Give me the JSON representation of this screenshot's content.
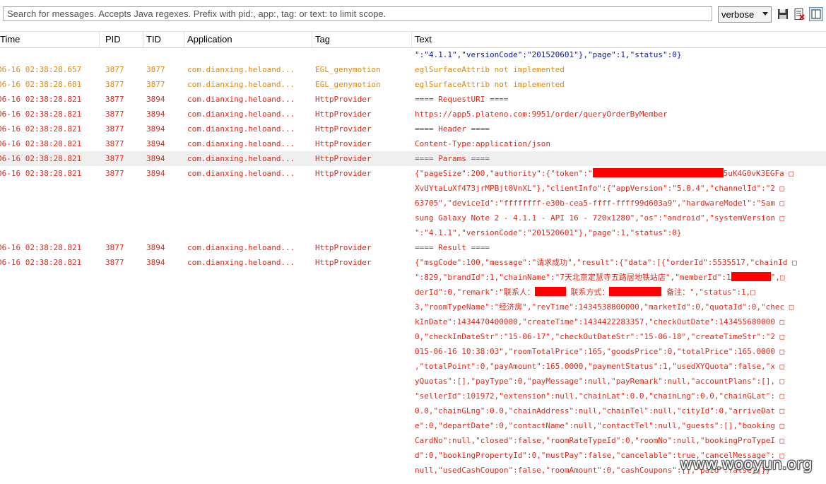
{
  "toolbar": {
    "search_placeholder": "Search for messages. Accepts Java regexes. Prefix with pid:, app:, tag: or text: to limit scope.",
    "level": "verbose",
    "icons": [
      "save-icon",
      "clear-log-icon",
      "toggle-columns-icon"
    ]
  },
  "columns": [
    "Time",
    "PID",
    "TID",
    "Application",
    "Tag",
    "Text"
  ],
  "rows": [
    {
      "time": "",
      "pid": "",
      "tid": "",
      "app": "",
      "tag": "",
      "text": "\":\"4.1.1\",\"versionCode\":\"201520601\"},\"page\":1,\"status\":0}",
      "color": "blue"
    },
    {
      "time": "06-16 02:38:28.657",
      "pid": "3877",
      "tid": "3877",
      "app": "com.dianxing.heloand...",
      "tag": "EGL_genymotion",
      "text": "eglSurfaceAttrib not implemented",
      "color": "orange"
    },
    {
      "time": "06-16 02:38:28.681",
      "pid": "3877",
      "tid": "3877",
      "app": "com.dianxing.heloand...",
      "tag": "EGL_genymotion",
      "text": "eglSurfaceAttrib not implemented",
      "color": "orange"
    },
    {
      "time": "06-16 02:38:28.821",
      "pid": "3877",
      "tid": "3894",
      "app": "com.dianxing.heloand...",
      "tag": "HttpProvider",
      "text": "==== RequestURI ====",
      "color": "red"
    },
    {
      "time": "06-16 02:38:28.821",
      "pid": "3877",
      "tid": "3894",
      "app": "com.dianxing.heloand...",
      "tag": "HttpProvider",
      "text": "https://app5.plateno.com:9951/order/queryOrderByMember",
      "color": "red"
    },
    {
      "time": "06-16 02:38:28.821",
      "pid": "3877",
      "tid": "3894",
      "app": "com.dianxing.heloand...",
      "tag": "HttpProvider",
      "text": "==== Header ====",
      "color": "red"
    },
    {
      "time": "06-16 02:38:28.821",
      "pid": "3877",
      "tid": "3894",
      "app": "com.dianxing.heloand...",
      "tag": "HttpProvider",
      "text": "Content-Type:application/json",
      "color": "red"
    },
    {
      "time": "06-16 02:38:28.821",
      "pid": "3877",
      "tid": "3894",
      "app": "com.dianxing.heloand...",
      "tag": "HttpProvider",
      "text": "==== Params ====",
      "color": "red",
      "selected": true
    },
    {
      "time": "06-16 02:38:28.821",
      "pid": "3877",
      "tid": "3894",
      "app": "com.dianxing.heloand...",
      "tag": "HttpProvider",
      "text_pre": "{\"pageSize\":200,\"authority\":{\"token\":\"",
      "text_post": "5uK4G0vK3EGFa □",
      "color": "red"
    },
    {
      "text": "XvUYtaLuXf473jrMPBjt0VnXL\"},\"clientInfo\":{\"appVersion\":\"5.0.4\",\"channelId\":\"2 □",
      "color": "red",
      "cont": true
    },
    {
      "text": "63705\",\"deviceId\":\"ffffffff-e30b-cea5-ffff-ffff99d603a9\",\"hardwareModel\":\"Sam □",
      "color": "red",
      "cont": true
    },
    {
      "text": "sung Galaxy Note 2 - 4.1.1 - API 16 - 720x1280\",\"os\":\"android\",\"systemVersion □",
      "color": "red",
      "cont": true
    },
    {
      "text": "\":\"4.1.1\",\"versionCode\":\"201520601\"},\"page\":1,\"status\":0}",
      "color": "red",
      "cont": true
    },
    {
      "time": "06-16 02:38:28.821",
      "pid": "3877",
      "tid": "3894",
      "app": "com.dianxing.heloand...",
      "tag": "HttpProvider",
      "text": "==== Result ====",
      "color": "red"
    },
    {
      "time": "06-16 02:38:28.821",
      "pid": "3877",
      "tid": "3894",
      "app": "com.dianxing.heloand...",
      "tag": "HttpProvider",
      "text": "{\"msgCode\":100,\"message\":\"请求成功\",\"result\":{\"data\":[{\"orderId\":5535517,\"chainId □",
      "color": "red"
    },
    {
      "text_pre": "\":829,\"brandId\":1,\"chainName\":\"7天北京定慧寺五路居地铁站店\",\"memberId\":1",
      "text_post": "\",□",
      "color": "red",
      "cont": true
    },
    {
      "text_pre": "derId\":0,\"remark\":\"联系人：",
      "text_mid": "  联系方式：",
      "text_post": "  备注：\",\"status\":1,□",
      "color": "red",
      "cont": true
    },
    {
      "text": "3,\"roomTypeName\":\"经济房\",\"revTime\":1434538800000,\"marketId\":0,\"quotaId\":0,\"chec □",
      "color": "red",
      "cont": true
    },
    {
      "text": "kInDate\":1434470400000,\"createTime\":1434422283357,\"checkOutDate\":143455680000 □",
      "color": "red",
      "cont": true
    },
    {
      "text": "0,\"checkInDateStr\":\"15-06-17\",\"checkOutDateStr\":\"15-06-18\",\"createTimeStr\":\"2 □",
      "color": "red",
      "cont": true
    },
    {
      "text": "015-06-16 10:38:03\",\"roomTotalPrice\":165,\"goodsPrice\":0,\"totalPrice\":165.0000 □",
      "color": "red",
      "cont": true
    },
    {
      "text": ",\"totalPoint\":0,\"payAmount\":165.0000,\"paymentStatus\":1,\"usedXYQuota\":false,\"x □",
      "color": "red",
      "cont": true
    },
    {
      "text": "yQuotas\":[],\"payType\":0,\"payMessage\":null,\"payRemark\":null,\"accountPlans\":[], □",
      "color": "red",
      "cont": true
    },
    {
      "text": "\"sellerId\":101972,\"extension\":null,\"chainLat\":0.0,\"chainLng\":0.0,\"chainGLat\": □",
      "color": "red",
      "cont": true
    },
    {
      "text": "0.0,\"chainGLng\":0.0,\"chainAddress\":null,\"chainTel\":null,\"cityId\":0,\"arriveDat □",
      "color": "red",
      "cont": true
    },
    {
      "text": "e\":0,\"departDate\":0,\"contactName\":null,\"contactTel\":null,\"guests\":[],\"booking □",
      "color": "red",
      "cont": true
    },
    {
      "text": "CardNo\":null,\"closed\":false,\"roomRateTypeId\":0,\"roomNo\":null,\"bookingProTypeI □",
      "color": "red",
      "cont": true
    },
    {
      "text": "d\":0,\"bookingPropertyId\":0,\"mustPay\":false,\"cancelable\":true,\"cancelMessage\": □",
      "color": "red",
      "cont": true
    },
    {
      "text": "null,\"usedCashCoupon\":false,\"roomAmount\":0,\"cashCoupons\":[],\"paid\":false}]}}",
      "color": "red",
      "cont": true
    }
  ],
  "watermark": "www.wooyun.org"
}
